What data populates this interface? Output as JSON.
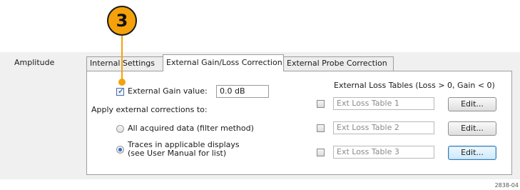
{
  "section_label": "Amplitude",
  "tabs": [
    {
      "label": "Internal Settings",
      "active": false
    },
    {
      "label": "External Gain/Loss Correction",
      "active": true
    },
    {
      "label": "External Probe Correction",
      "active": false
    }
  ],
  "gain": {
    "checkbox_label": "External Gain value:",
    "checked": true,
    "value": "0.0 dB"
  },
  "apply": {
    "heading": "Apply external corrections to:",
    "options": [
      {
        "label": "All acquired data (filter method)",
        "selected": false
      },
      {
        "label_line1": "Traces in applicable displays",
        "label_line2": "(see User Manual for list)",
        "selected": true
      }
    ]
  },
  "loss_tables": {
    "heading": "External Loss Tables (Loss > 0, Gain < 0)",
    "rows": [
      {
        "name": "Ext Loss Table 1",
        "button": "Edit...",
        "checked": false
      },
      {
        "name": "Ext Loss Table 2",
        "button": "Edit...",
        "checked": false
      },
      {
        "name": "Ext Loss Table 3",
        "button": "Edit...",
        "checked": false
      }
    ]
  },
  "callout": {
    "number": "3",
    "color": "#f4a10b"
  },
  "figure_number": "2838-04"
}
